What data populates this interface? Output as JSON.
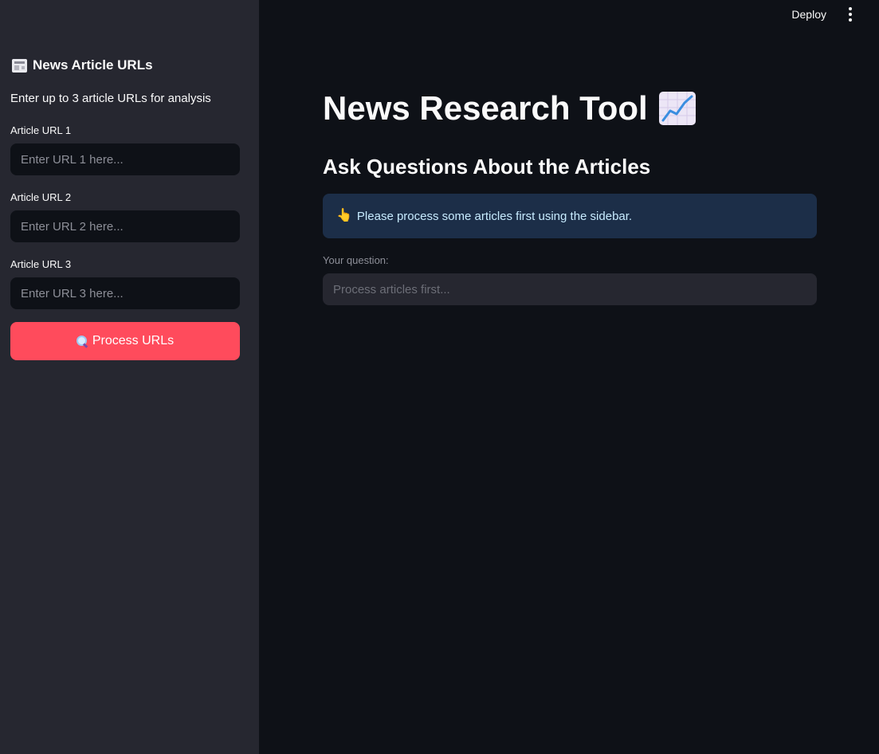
{
  "sidebar": {
    "header": "News Article URLs",
    "header_icon": "newspaper-icon",
    "caption": "Enter up to 3 article URLs for analysis",
    "fields": [
      {
        "label": "Article URL 1",
        "placeholder": "Enter URL 1 here...",
        "value": ""
      },
      {
        "label": "Article URL 2",
        "placeholder": "Enter URL 2 here...",
        "value": ""
      },
      {
        "label": "Article URL 3",
        "placeholder": "Enter URL 3 here...",
        "value": ""
      }
    ],
    "process_button": {
      "label": "Process URLs",
      "icon": "magnifier-icon",
      "color": "#ff4b5c"
    }
  },
  "toolbar": {
    "deploy_label": "Deploy",
    "menu_icon": "vertical-dots-icon"
  },
  "main": {
    "title": "News Research Tool",
    "title_icon": "chart-increasing-icon",
    "subheader": "Ask Questions About the Articles",
    "info": {
      "icon": "pointing-hand-icon",
      "text": "Please process some articles first using the sidebar."
    },
    "question": {
      "label": "Your question:",
      "placeholder": "Process articles first...",
      "value": ""
    }
  },
  "colors": {
    "background": "#0e1117",
    "sidebar": "#262730",
    "info_bg": "#1c2e48",
    "info_text": "#c7ebff",
    "accent": "#ff4b5c"
  }
}
